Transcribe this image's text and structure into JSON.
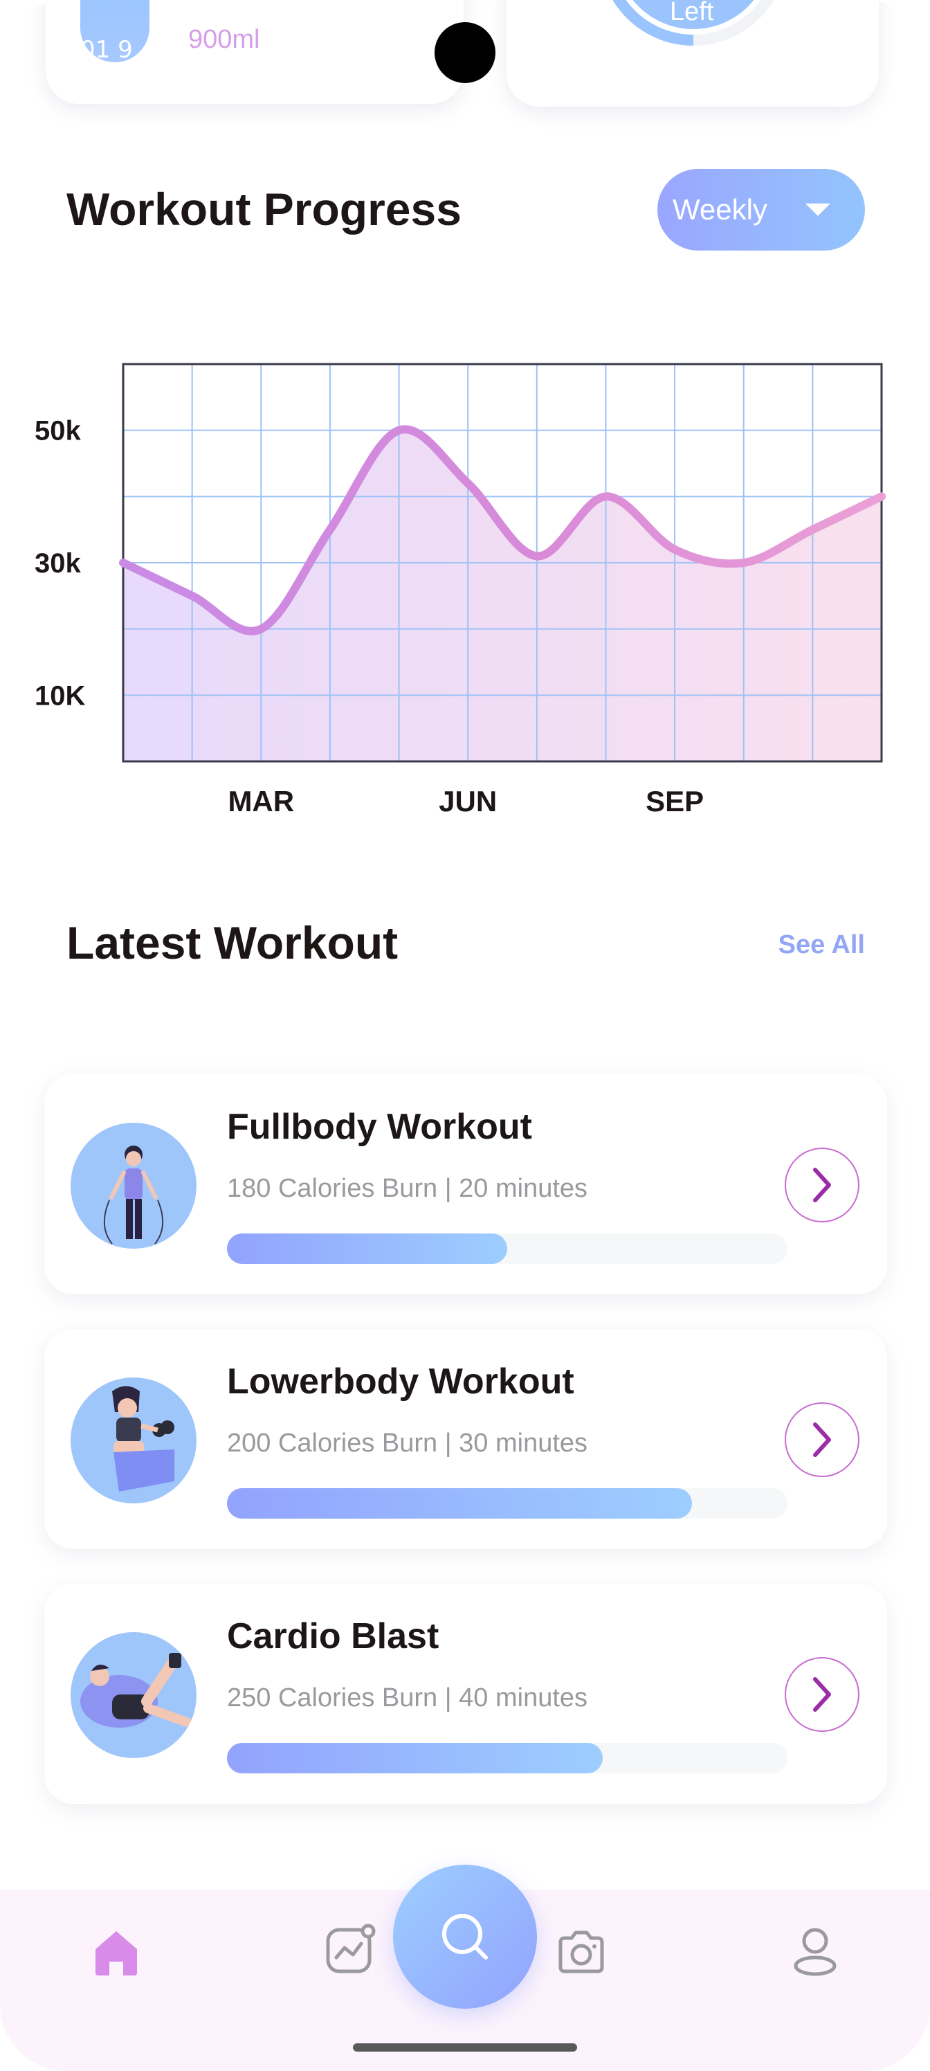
{
  "top_cards": {
    "water_bar_label": "01 9",
    "water_amount": "900ml",
    "calorie_ring_label": "Left"
  },
  "workout_progress": {
    "title": "Workout Progress",
    "period_select": "Weekly"
  },
  "chart_data": {
    "type": "area",
    "x_tick_labels": [
      "MAR",
      "JUN",
      "SEP"
    ],
    "y_tick_labels": [
      "50k",
      "30k",
      "10K"
    ],
    "x": [
      1,
      2,
      3,
      4,
      5,
      6,
      7,
      8,
      9,
      10,
      11,
      12
    ],
    "values": [
      30000,
      25000,
      20000,
      35000,
      50000,
      42000,
      31000,
      40000,
      32000,
      30000,
      35000,
      40000
    ],
    "ylim": [
      0,
      60000
    ],
    "grid": true,
    "colors": {
      "line": "#d58ee3",
      "fill_start": "#e7dafb",
      "fill_end": "#f9e0ee",
      "grid": "#9cc2f6"
    }
  },
  "latest_workout": {
    "title": "Latest Workout",
    "see_all": "See All",
    "items": [
      {
        "title": "Fullbody Workout",
        "subtitle": "180 Calories Burn | 20 minutes",
        "progress": 0.5
      },
      {
        "title": "Lowerbody Workout",
        "subtitle": "200 Calories Burn | 30 minutes",
        "progress": 0.83
      },
      {
        "title": "Cardio Blast",
        "subtitle": "250 Calories Burn | 40 minutes",
        "progress": 0.67
      }
    ]
  },
  "bottom_nav": {
    "items": [
      "home-icon",
      "activity-icon",
      "search-icon",
      "camera-icon",
      "profile-icon"
    ],
    "active": "home-icon",
    "colors": {
      "active": "#d88be8",
      "inactive": "#9a9a9e"
    }
  }
}
